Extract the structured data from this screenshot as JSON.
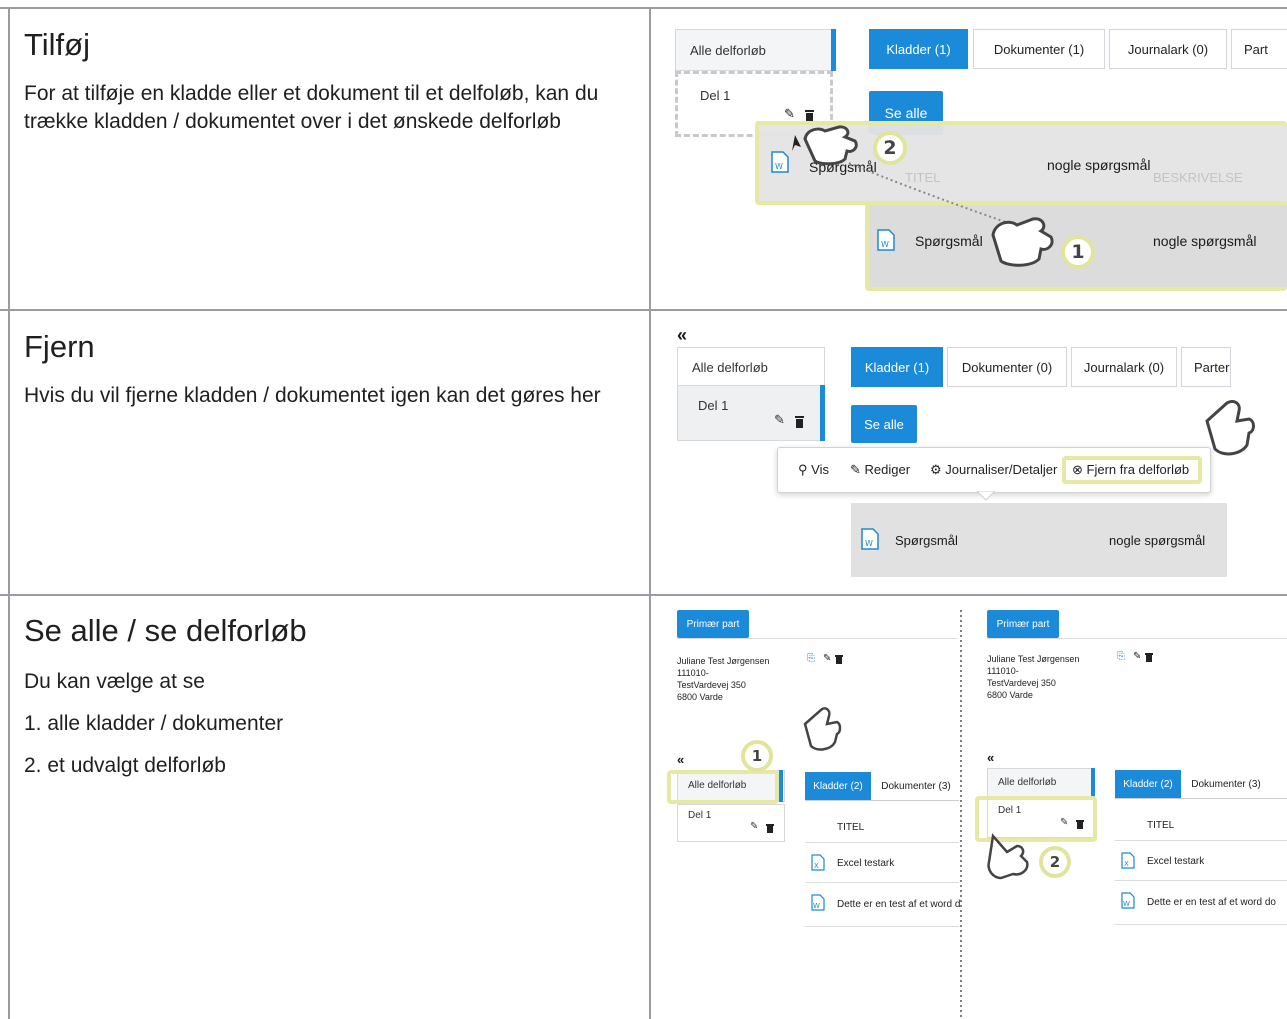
{
  "rows": [
    {
      "heading": "Tilføj",
      "text": "For at tilføje en kladde eller et dokument til et delfoløb, kan du trække kladden / dokumentet over i det ønskede delforløb"
    },
    {
      "heading": "Fjern",
      "text": "Hvis du vil fjerne kladden / dokumentet igen kan det gøres her"
    },
    {
      "heading": "Se alle / se delforløb",
      "text": "Du kan vælge at se",
      "list": [
        "1. alle kladder / dokumenter",
        "2. et udvalgt delforløb"
      ]
    }
  ],
  "ill1": {
    "side_all": "Alle delforløb",
    "side_del": "Del 1",
    "tabs": [
      "Kladder (1)",
      "Dokumenter (1)",
      "Journalark (0)",
      "Part"
    ],
    "se_alle": "Se alle",
    "drag_title": "Spørgsmål",
    "drag_desc": "nogle spørgsmål",
    "col_title": "TITEL",
    "col_desc": "BESKRIVELSE",
    "row_title": "Spørgsmål",
    "row_desc": "nogle spørgsmål",
    "badge1": "1",
    "badge2": "2"
  },
  "ill2": {
    "collapse": "«",
    "side_all": "Alle delforløb",
    "side_del": "Del 1",
    "tabs": [
      "Kladder (1)",
      "Dokumenter (0)",
      "Journalark (0)",
      "Parter"
    ],
    "se_alle": "Se alle",
    "menu": [
      "Vis",
      "Rediger",
      "Journaliser/Detaljer",
      "Fjern fra delforløb"
    ],
    "row_title": "Spørgsmål",
    "row_desc": "nogle spørgsmål"
  },
  "ill3": {
    "panels": [
      {
        "primary": "Primær part",
        "name": "Juliane Test Jørgensen",
        "id": "111010-",
        "street": "TestVardevej 350",
        "city": "6800 Varde",
        "collapse": "«",
        "side_all": "Alle delforløb",
        "side_del": "Del 1",
        "tabs": [
          "Kladder (2)",
          "Dokumenter (3)"
        ],
        "col_title": "TITEL",
        "rows": [
          "Excel testark",
          "Dette er en test af et word d"
        ],
        "badge": "1"
      },
      {
        "primary": "Primær part",
        "name": "Juliane Test Jørgensen",
        "id": "111010-",
        "street": "TestVardevej 350",
        "city": "6800 Varde",
        "collapse": "«",
        "side_all": "Alle delforløb",
        "side_del": "Del 1",
        "tabs": [
          "Kladder (2)",
          "Dokumenter (3)"
        ],
        "col_title": "TITEL",
        "rows": [
          "Excel testark",
          "Dette er en test af et word do"
        ],
        "badge": "2"
      }
    ]
  },
  "colors": {
    "accent": "#1b8ad8",
    "highlight": "#e6e9a4",
    "grid": "#9a9ca3"
  }
}
